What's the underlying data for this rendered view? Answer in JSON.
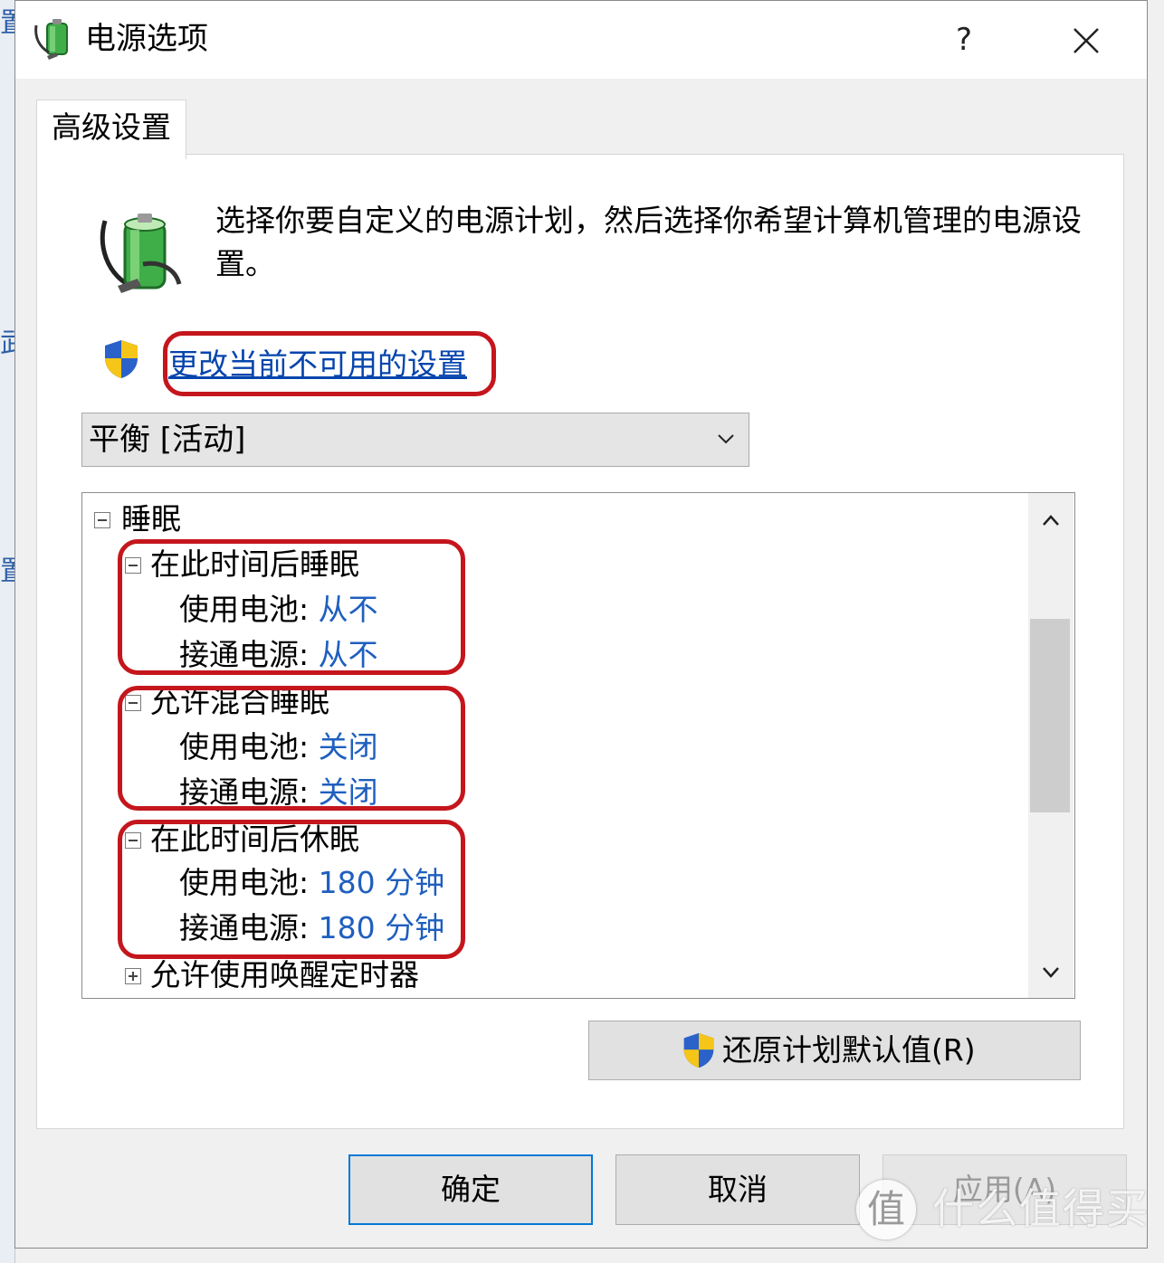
{
  "background": {
    "chars": [
      "置",
      "武",
      "置"
    ]
  },
  "window": {
    "title": "电源选项",
    "help": "?"
  },
  "tab": {
    "label": "高级设置"
  },
  "description": "选择你要自定义的电源计划，然后选择你希望计算机管理的电源设置。",
  "link": "更改当前不可用的设置",
  "plan_select": {
    "value": "平衡 [活动]"
  },
  "tree": {
    "root": "睡眠",
    "groups": [
      {
        "label": "在此时间后睡眠",
        "battery_label": "使用电池:",
        "battery_value": "从不",
        "plugged_label": "接通电源:",
        "plugged_value": "从不"
      },
      {
        "label": "允许混合睡眠",
        "battery_label": "使用电池:",
        "battery_value": "关闭",
        "plugged_label": "接通电源:",
        "plugged_value": "关闭"
      },
      {
        "label": "在此时间后休眠",
        "battery_label": "使用电池:",
        "battery_value": "180 分钟",
        "plugged_label": "接通电源:",
        "plugged_value": "180 分钟"
      }
    ],
    "collapsed_item": "允许使用唤醒定时器"
  },
  "restore_button": "还原计划默认值(R)",
  "buttons": {
    "ok": "确定",
    "cancel": "取消",
    "apply": "应用(A)"
  },
  "watermark": {
    "icon": "值",
    "text": "什么值得买"
  },
  "colors": {
    "accent": "#0078d7",
    "link": "#0645ad",
    "value": "#1f5fbf",
    "highlight": "#c4161c"
  }
}
